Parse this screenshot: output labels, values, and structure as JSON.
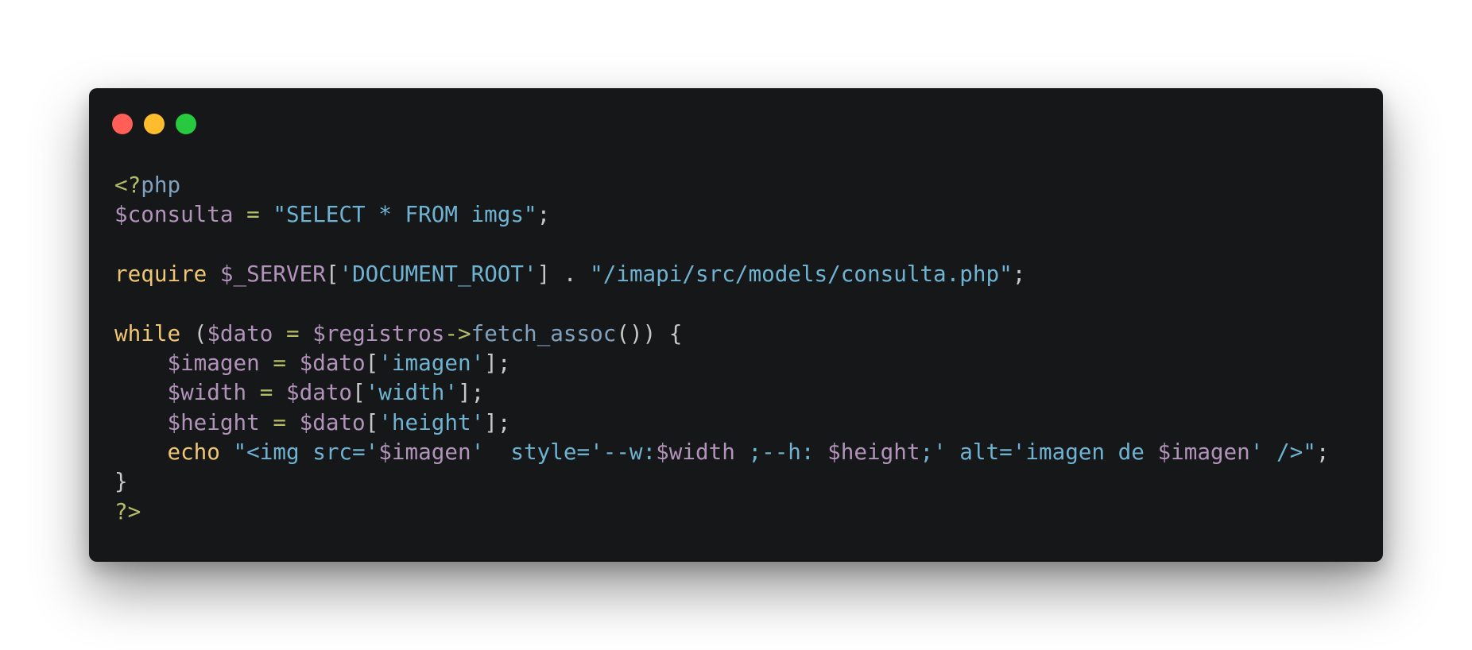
{
  "colors": {
    "background": "#ffffff",
    "window": "#161719",
    "close": "#ff5f56",
    "minimize": "#ffbd2e",
    "maximize": "#27c93f",
    "punct": "#c5c8c6",
    "tag": "#b5bd68",
    "variable": "#b294bb",
    "string": "#6fb3d2",
    "keyword": "#f0c674",
    "operator": "#b5bd68",
    "function": "#81a2be"
  },
  "window_controls": [
    "close",
    "minimize",
    "maximize"
  ],
  "code": {
    "language": "php",
    "lines": [
      [
        {
          "t": "<?",
          "c": "tag"
        },
        {
          "t": "php",
          "c": "function"
        }
      ],
      [
        {
          "t": "$consulta",
          "c": "variable"
        },
        {
          "t": " = ",
          "c": "operator"
        },
        {
          "t": "\"SELECT * FROM imgs\"",
          "c": "string"
        },
        {
          "t": ";",
          "c": "punct"
        }
      ],
      [],
      [
        {
          "t": "require",
          "c": "keyword"
        },
        {
          "t": " ",
          "c": "punct"
        },
        {
          "t": "$_SERVER",
          "c": "variable"
        },
        {
          "t": "[",
          "c": "punct"
        },
        {
          "t": "'DOCUMENT_ROOT'",
          "c": "string"
        },
        {
          "t": "] . ",
          "c": "punct"
        },
        {
          "t": "\"/imapi/src/models/consulta.php\"",
          "c": "string"
        },
        {
          "t": ";",
          "c": "punct"
        }
      ],
      [],
      [
        {
          "t": "while",
          "c": "keyword"
        },
        {
          "t": " (",
          "c": "punct"
        },
        {
          "t": "$dato",
          "c": "variable"
        },
        {
          "t": " = ",
          "c": "operator"
        },
        {
          "t": "$registros",
          "c": "variable"
        },
        {
          "t": "->",
          "c": "operator"
        },
        {
          "t": "fetch_assoc",
          "c": "function"
        },
        {
          "t": "()) {",
          "c": "punct"
        }
      ],
      [
        {
          "t": "    ",
          "c": "punct"
        },
        {
          "t": "$imagen",
          "c": "variable"
        },
        {
          "t": " = ",
          "c": "operator"
        },
        {
          "t": "$dato",
          "c": "variable"
        },
        {
          "t": "[",
          "c": "punct"
        },
        {
          "t": "'imagen'",
          "c": "string"
        },
        {
          "t": "];",
          "c": "punct"
        }
      ],
      [
        {
          "t": "    ",
          "c": "punct"
        },
        {
          "t": "$width",
          "c": "variable"
        },
        {
          "t": " = ",
          "c": "operator"
        },
        {
          "t": "$dato",
          "c": "variable"
        },
        {
          "t": "[",
          "c": "punct"
        },
        {
          "t": "'width'",
          "c": "string"
        },
        {
          "t": "];",
          "c": "punct"
        }
      ],
      [
        {
          "t": "    ",
          "c": "punct"
        },
        {
          "t": "$height",
          "c": "variable"
        },
        {
          "t": " = ",
          "c": "operator"
        },
        {
          "t": "$dato",
          "c": "variable"
        },
        {
          "t": "[",
          "c": "punct"
        },
        {
          "t": "'height'",
          "c": "string"
        },
        {
          "t": "];",
          "c": "punct"
        }
      ],
      [
        {
          "t": "    ",
          "c": "punct"
        },
        {
          "t": "echo",
          "c": "keyword"
        },
        {
          "t": " ",
          "c": "punct"
        },
        {
          "t": "\"<img src='",
          "c": "string"
        },
        {
          "t": "$imagen",
          "c": "variable"
        },
        {
          "t": "'  style='--w:",
          "c": "string"
        },
        {
          "t": "$width",
          "c": "variable"
        },
        {
          "t": " ;--h: ",
          "c": "string"
        },
        {
          "t": "$height",
          "c": "variable"
        },
        {
          "t": ";' alt='imagen de ",
          "c": "string"
        },
        {
          "t": "$imagen",
          "c": "variable"
        },
        {
          "t": "' />\"",
          "c": "string"
        },
        {
          "t": ";",
          "c": "punct"
        }
      ],
      [
        {
          "t": "}",
          "c": "punct"
        }
      ],
      [
        {
          "t": "?>",
          "c": "tag"
        }
      ]
    ]
  }
}
